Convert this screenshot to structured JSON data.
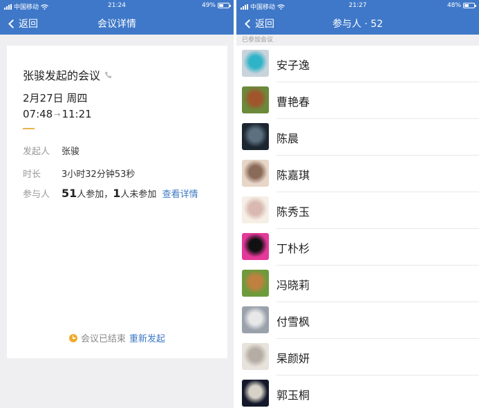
{
  "left": {
    "status": {
      "carrier": "中国移动",
      "time": "21:24",
      "battery": "49%",
      "battery_level": 0.49
    },
    "nav": {
      "back_label": "返回",
      "title": "会议详情"
    },
    "card": {
      "creator_title": "张骏发起的会议",
      "date": "2月27日 周四",
      "start_time": "07:48",
      "end_time": "11:21",
      "host_label": "发起人",
      "host_value": "张骏",
      "duration_label": "时长",
      "duration_value": "3小时32分钟53秒",
      "participants_label": "参与人",
      "joined_count": "51",
      "joined_text": "人参加，",
      "not_joined_count": "1",
      "not_joined_text": "人未参加",
      "details_link": "查看详情",
      "ended_text": "会议已结束",
      "restart_link": "重新发起"
    }
  },
  "right": {
    "status": {
      "carrier": "中国移动",
      "time": "21:27",
      "battery": "48%",
      "battery_level": 0.48
    },
    "nav": {
      "back_label": "返回",
      "title": "参与人 · 52"
    },
    "section_label": "已参加会议",
    "participants": [
      {
        "name": "安子逸",
        "avatar_colors": [
          "#c9d3dc",
          "#2fb3c8"
        ]
      },
      {
        "name": "曹艳春",
        "avatar_colors": [
          "#6b8a3a",
          "#a0552d"
        ]
      },
      {
        "name": "陈晨",
        "avatar_colors": [
          "#1c2630",
          "#5c7080"
        ]
      },
      {
        "name": "陈嘉琪",
        "avatar_colors": [
          "#e7d6c8",
          "#8a6a58"
        ]
      },
      {
        "name": "陈秀玉",
        "avatar_colors": [
          "#f6efe6",
          "#d8b8b0"
        ]
      },
      {
        "name": "丁朴杉",
        "avatar_colors": [
          "#e5399a",
          "#111111"
        ]
      },
      {
        "name": "冯晓莉",
        "avatar_colors": [
          "#6d9a3c",
          "#c08040"
        ]
      },
      {
        "name": "付雪枫",
        "avatar_colors": [
          "#9aa1ab",
          "#e8e8e8"
        ]
      },
      {
        "name": "杲颜妍",
        "avatar_colors": [
          "#e7e3dc",
          "#b5aca3"
        ]
      },
      {
        "name": "郭玉桐",
        "avatar_colors": [
          "#14182a",
          "#d6d2c8"
        ]
      }
    ]
  }
}
